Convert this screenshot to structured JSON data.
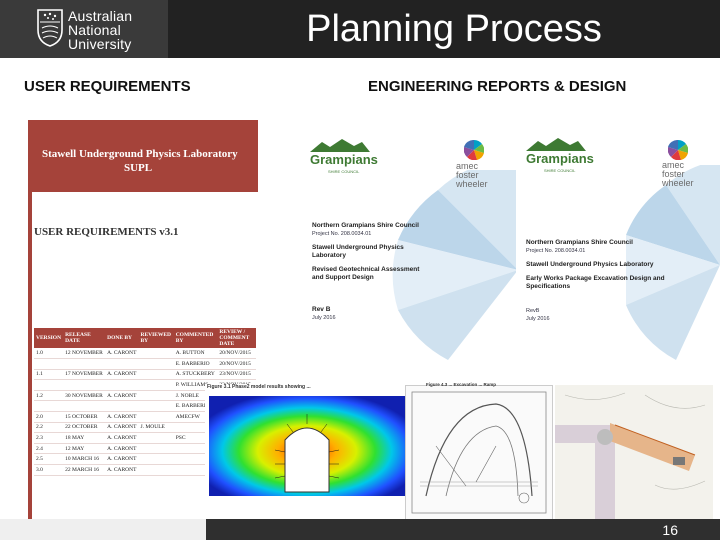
{
  "header": {
    "university": [
      "Australian",
      "National",
      "University"
    ],
    "title": "Planning Process"
  },
  "columns": {
    "left": "USER REQUIREMENTS",
    "right": "ENGINEERING REPORTS & DESIGN"
  },
  "user_requirements_doc": {
    "banner_line1": "Stawell Underground Physics Laboratory",
    "banner_line2": "SUPL",
    "subtitle": "USER REQUIREMENTS v3.1",
    "table_headers": [
      "VERSION",
      "RELEASE DATE",
      "DONE BY",
      "REVIEWED BY",
      "COMMENTED BY",
      "REVIEW / COMMENT DATE"
    ],
    "rows": [
      [
        "1.0",
        "12 NOVEMBER",
        "A. CARONT",
        "",
        "A. BUTTON",
        "20/NOV/2015"
      ],
      [
        "",
        "",
        "",
        "",
        "E. BARBERIO",
        "20/NOV/2015"
      ],
      [
        "1.1",
        "17 NOVEMBER",
        "A. CARONT",
        "",
        "A. STUCKBERY",
        "23/NOV/2015"
      ],
      [
        "",
        "",
        "",
        "",
        "P. WILLIAMS",
        "23/NOV/2015"
      ],
      [
        "1.2",
        "30 NOVEMBER",
        "A. CARONT",
        "",
        "J. NOBLE",
        "30/NOV/2015"
      ],
      [
        "",
        "",
        "",
        "",
        "E. BARBERIO",
        "30/NOV/2015"
      ],
      [
        "2.0",
        "15 OCTOBER",
        "A. CARONT",
        "",
        "AMECFW",
        ""
      ],
      [
        "2.2",
        "22 OCTOBER",
        "A. CARONT",
        "J. MOULE",
        "",
        ""
      ],
      [
        "2.3",
        "18 MAY",
        "A. CARONT",
        "",
        "PSC",
        ""
      ],
      [
        "2.4",
        "12 MAY",
        "A. CARONT",
        "",
        "",
        ""
      ],
      [
        "2.5",
        "10 MARCH 16",
        "A. CARONT",
        "",
        "",
        ""
      ],
      [
        "3.0",
        "22 MARCH 16",
        "A. CARONT",
        "",
        "",
        ""
      ]
    ]
  },
  "ng_doc": {
    "logo": "Grampians",
    "logo_top": "NORTHERN",
    "logo_sub": "SHIRE COUNCIL",
    "amec": [
      "amec",
      "foster",
      "wheeler"
    ],
    "lines": [
      "Northern Grampians Shire Council",
      "Project No. 208.0034.01"
    ],
    "title": "Stawell Underground Physics Laboratory",
    "subtitle": "Revised Geotechnical Assessment and Support Design",
    "rev": "Rev B",
    "date": "July 2016"
  },
  "amec_doc": {
    "logo": "Grampians",
    "logo_top": "NORTHERN",
    "logo_sub": "SHIRE COUNCIL",
    "amec": [
      "amec",
      "foster",
      "wheeler"
    ],
    "lines": [
      "Northern Grampians Shire Council",
      "Project No. 208.0034.01"
    ],
    "title": "Stawell Underground Physics Laboratory",
    "subtitle": "Early Works Package Excavation Design and Specifications",
    "rev": "RevB",
    "date": "July 2016"
  },
  "figures": {
    "heatmap_caption": "Figure 3.1  Phase2 model results showing ...",
    "drawing_caption": "Figure 4.3  ... Excavation ... Ramp"
  },
  "footer": {
    "page_number": "16"
  },
  "colors": {
    "logo_bg": "#3a3a3a",
    "title_bg": "#222222",
    "banner_red": "#a5433a",
    "footer_bg": "#2f2f2f"
  }
}
